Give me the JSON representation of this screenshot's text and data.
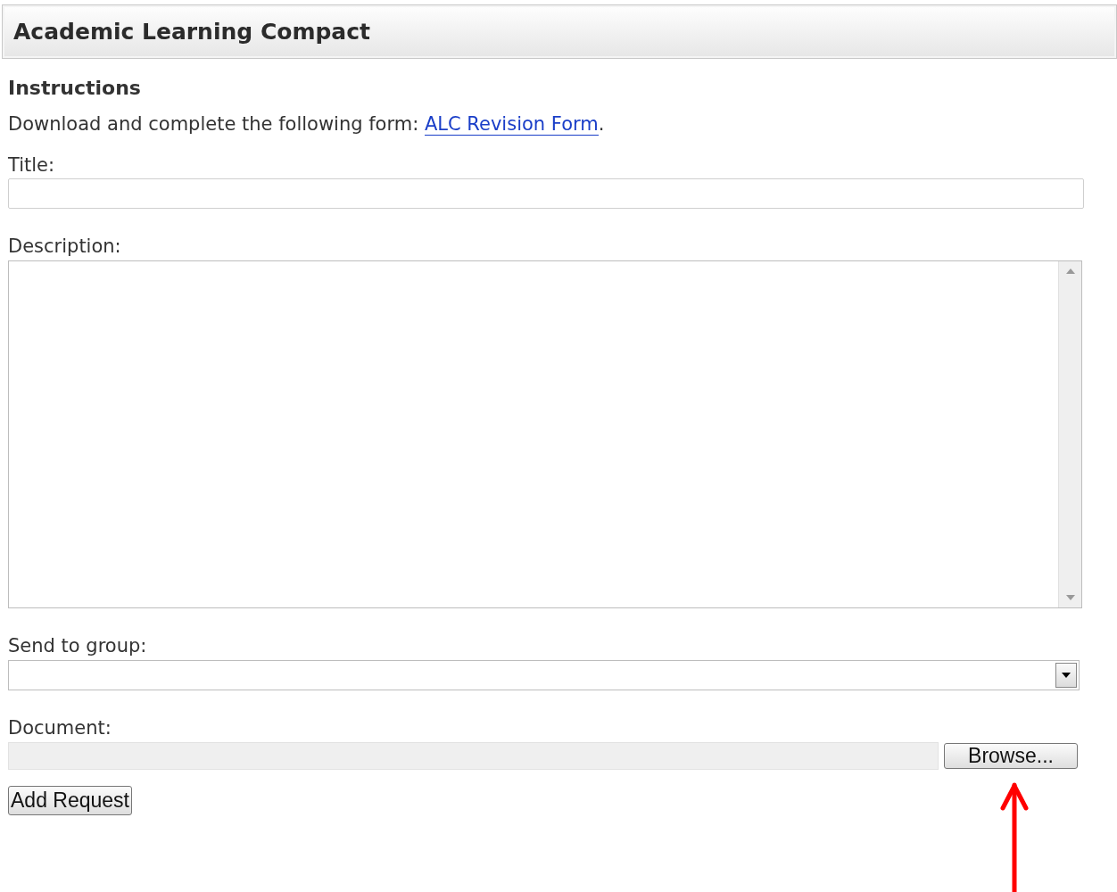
{
  "header": {
    "title": "Academic Learning Compact"
  },
  "instructions": {
    "heading": "Instructions",
    "text": "Download and complete the following form: ",
    "link": "ALC Revision Form",
    "after_link": "."
  },
  "form": {
    "title_label": "Title:",
    "description_label": "Description:",
    "group_label": "Send to group:",
    "document_label": "Document:",
    "browse_button": "Browse...",
    "submit_button": "Add Request"
  }
}
